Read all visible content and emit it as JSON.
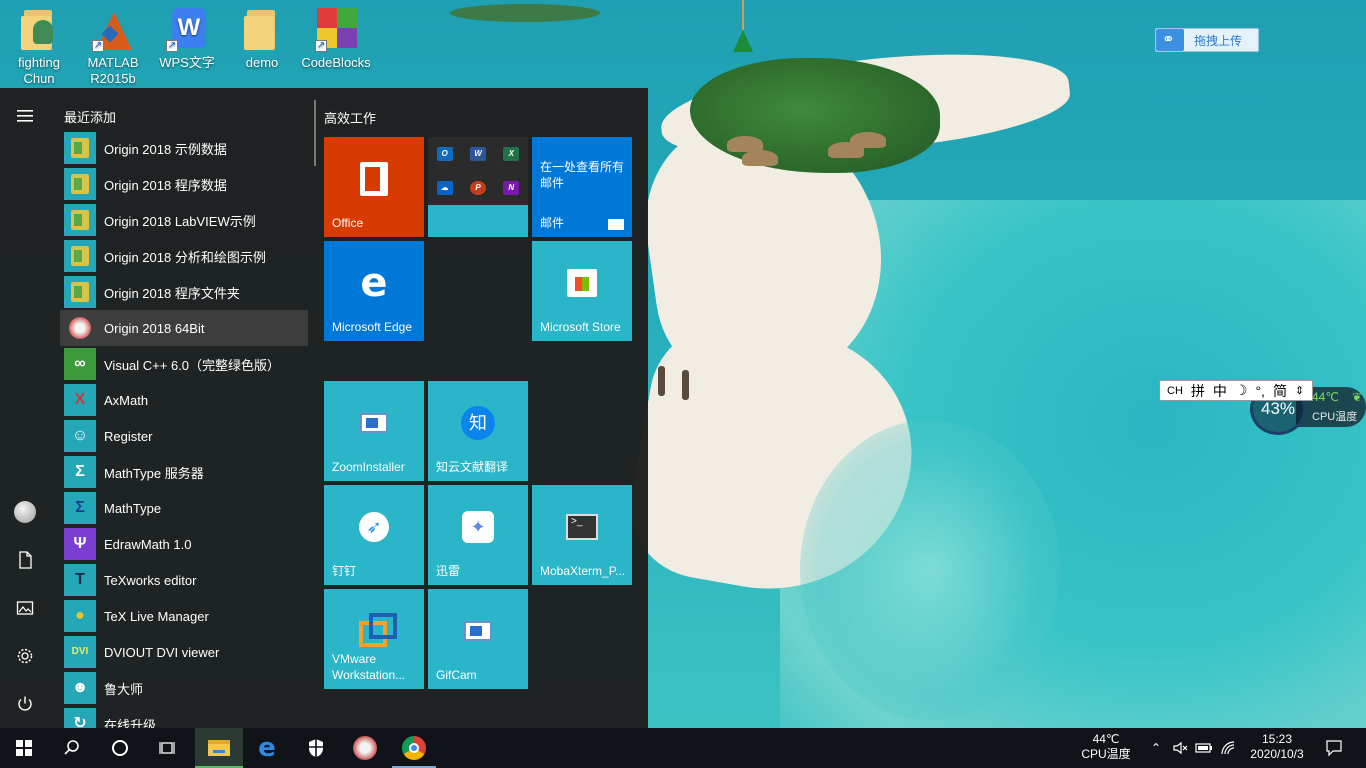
{
  "desktop": {
    "icons": [
      {
        "label": "fighting\nChun",
        "icon": "user-folder-icon"
      },
      {
        "label": "MATLAB\nR2015b",
        "icon": "matlab-icon"
      },
      {
        "label": "WPS文字",
        "icon": "wps-writer-icon"
      },
      {
        "label": "demo",
        "icon": "folder-icon"
      },
      {
        "label": "CodeBlocks",
        "icon": "codeblocks-icon"
      }
    ],
    "upload_widget": "拖拽上传",
    "ime_bar": [
      "CH",
      "拼",
      "中",
      "☽",
      "°,",
      "简"
    ],
    "cpu_widget": {
      "percent": "43%",
      "temp": "44℃",
      "label": "CPU温度"
    }
  },
  "start_menu": {
    "recent_title": "最近添加",
    "apps": [
      {
        "label": "Origin 2018 示例数据",
        "icon": "origin-folder-icon"
      },
      {
        "label": "Origin 2018 程序数据",
        "icon": "origin-folder-icon"
      },
      {
        "label": "Origin 2018 LabVIEW示例",
        "icon": "origin-folder-icon"
      },
      {
        "label": "Origin 2018 分析和绘图示例",
        "icon": "origin-folder-icon"
      },
      {
        "label": "Origin 2018 程序文件夹",
        "icon": "origin-folder-icon"
      },
      {
        "label": "Origin 2018 64Bit",
        "icon": "origin-app-icon"
      },
      {
        "label": "Visual C++ 6.0（完整绿色版）",
        "icon": "visual-cpp-icon"
      },
      {
        "label": "AxMath",
        "icon": "axmath-icon"
      },
      {
        "label": "Register",
        "icon": "register-icon"
      },
      {
        "label": "MathType 服务器",
        "icon": "mathtype-server-icon"
      },
      {
        "label": "MathType",
        "icon": "mathtype-icon"
      },
      {
        "label": "EdrawMath 1.0",
        "icon": "edrawmath-icon"
      },
      {
        "label": "TeXworks editor",
        "icon": "texworks-icon"
      },
      {
        "label": "TeX Live Manager",
        "icon": "texlive-icon"
      },
      {
        "label": "DVIOUT DVI viewer",
        "icon": "dviout-icon"
      },
      {
        "label": "鲁大师",
        "icon": "ludashi-icon"
      },
      {
        "label": "在线升级",
        "icon": "update-icon"
      }
    ],
    "group_title": "高效工作",
    "tiles": {
      "office": "Office",
      "mail_headline": "在一处查看所有邮件",
      "mail": "邮件",
      "edge": "Microsoft Edge",
      "store": "Microsoft Store",
      "zoom": "ZoomInstaller",
      "zhiyun": "知云文献翻译",
      "dingtalk": "钉钉",
      "xunlei": "迅雷",
      "moba": "MobaXterm_P...",
      "vmware": "VMware Workstation...",
      "gifcam": "GifCam"
    },
    "office_apps": [
      "O",
      "W",
      "X",
      "☁",
      "P",
      "N"
    ]
  },
  "taskbar": {
    "cpu_temp": "44℃",
    "cpu_label": "CPU温度",
    "time": "15:23",
    "date": "2020/10/3"
  },
  "colors": {
    "office_tile": "#d83b01",
    "teal_tile": "#2ab5c9",
    "blue_tile": "#0078d7",
    "start_bg": "#1e1e1e",
    "taskbar_bg": "#101418"
  }
}
